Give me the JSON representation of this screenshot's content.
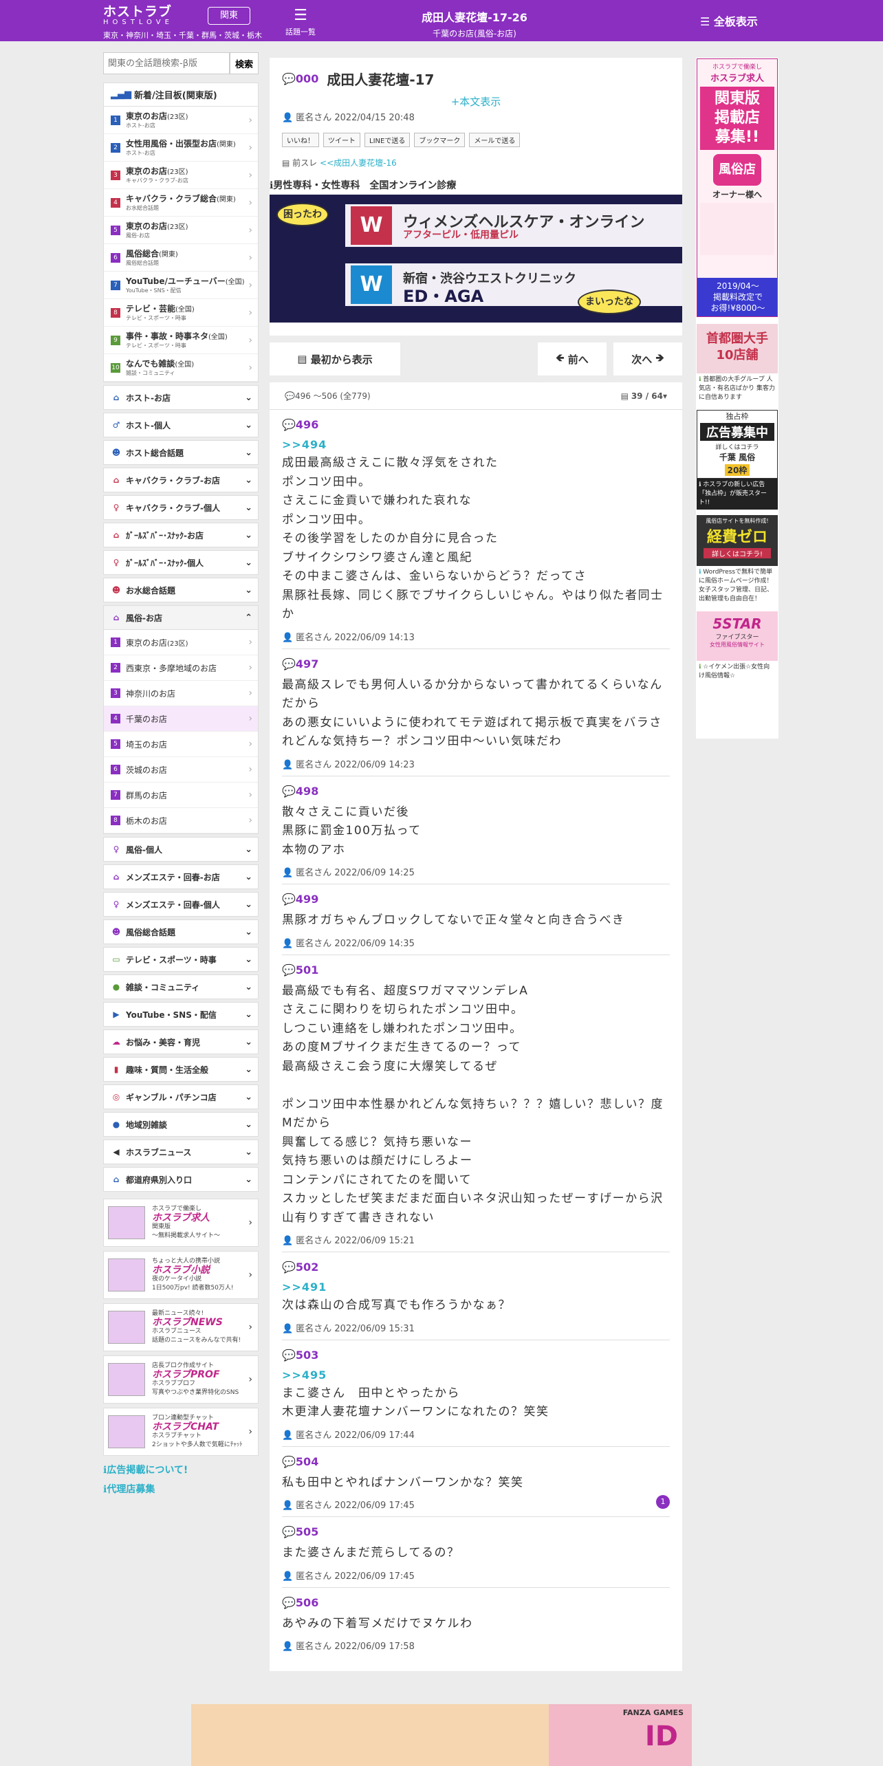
{
  "header": {
    "logo_main": "ホストラブ",
    "logo_sub": "HOSTLOVE",
    "region": "関東",
    "areas": "東京・神奈川・埼玉・千葉・群馬・茨城・栃木",
    "topics_label": "話題一覧",
    "thread_title": "成田人妻花壇-17-26",
    "thread_sub": "千葉のお店(風俗-お店)",
    "menu_label": "全板表示",
    "brand_color": "#8a2fc0"
  },
  "sidebar": {
    "search_placeholder": "関東の全話題検索-β版",
    "search_button": "検索",
    "box_title": "新着/注目板(関東版)",
    "boards": [
      {
        "n": "1",
        "color": "#2b5fb8",
        "name": "東京のお店",
        "scope": "(23区)",
        "sub": "ホスト-お店"
      },
      {
        "n": "2",
        "color": "#2b5fb8",
        "name": "女性用風俗・出張型お店",
        "scope": "(関東)",
        "sub": "ホスト-お店"
      },
      {
        "n": "3",
        "color": "#c4314b",
        "name": "東京のお店",
        "scope": "(23区)",
        "sub": "キャバクラ・クラブ-お店"
      },
      {
        "n": "4",
        "color": "#c4314b",
        "name": "キャバクラ・クラブ総合",
        "scope": "(関東)",
        "sub": "お水総合話題"
      },
      {
        "n": "5",
        "color": "#8a2fc0",
        "name": "東京のお店",
        "scope": "(23区)",
        "sub": "風俗-お店"
      },
      {
        "n": "6",
        "color": "#8a2fc0",
        "name": "風俗総合",
        "scope": "(関東)",
        "sub": "風俗総合話題"
      },
      {
        "n": "7",
        "color": "#2b5fb8",
        "name": "YouTube/ユーチューバー",
        "scope": "(全国)",
        "sub": "YouTube・SNS・配信"
      },
      {
        "n": "8",
        "color": "#c4314b",
        "name": "テレビ・芸能",
        "scope": "(全国)",
        "sub": "テレビ・スポーツ・時事"
      },
      {
        "n": "9",
        "color": "#5a9a3a",
        "name": "事件・事故・時事ネタ",
        "scope": "(全国)",
        "sub": "テレビ・スポーツ・時事"
      },
      {
        "n": "10",
        "color": "#5a9a3a",
        "name": "なんでも雑談",
        "scope": "(全国)",
        "sub": "雑談・コミュニティ"
      }
    ],
    "categories_a": [
      {
        "icon": "⌂",
        "color": "#2b5fb8",
        "label": "ホスト-お店",
        "chev": "⌄"
      },
      {
        "icon": "♂",
        "color": "#2b5fb8",
        "label": "ホスト-個人",
        "chev": "⌄"
      },
      {
        "icon": "☻",
        "color": "#2b5fb8",
        "label": "ホスト総合話題",
        "chev": "⌄"
      },
      {
        "icon": "⌂",
        "color": "#c4314b",
        "label": "キャバクラ・クラブ-お店",
        "chev": "⌄"
      },
      {
        "icon": "♀",
        "color": "#c4314b",
        "label": "キャバクラ・クラブ-個人",
        "chev": "⌄"
      },
      {
        "icon": "⌂",
        "color": "#c4314b",
        "label": "ｶﾞｰﾙｽﾞﾊﾞｰ･ｽﾅｯｸ-お店",
        "chev": "⌄"
      },
      {
        "icon": "♀",
        "color": "#c4314b",
        "label": "ｶﾞｰﾙｽﾞﾊﾞｰ･ｽﾅｯｸ-個人",
        "chev": "⌄"
      },
      {
        "icon": "☻",
        "color": "#c4314b",
        "label": "お水総合話題",
        "chev": "⌄"
      }
    ],
    "fuzoku_label": "風俗-お店",
    "fuzoku_chev": "⌃",
    "fuzoku_items": [
      {
        "n": "1",
        "label": "東京のお店",
        "scope": "(23区)"
      },
      {
        "n": "2",
        "label": "西東京・多摩地域のお店",
        "scope": ""
      },
      {
        "n": "3",
        "label": "神奈川のお店",
        "scope": ""
      },
      {
        "n": "4",
        "label": "千葉のお店",
        "scope": ""
      },
      {
        "n": "5",
        "label": "埼玉のお店",
        "scope": ""
      },
      {
        "n": "6",
        "label": "茨城のお店",
        "scope": ""
      },
      {
        "n": "7",
        "label": "群馬のお店",
        "scope": ""
      },
      {
        "n": "8",
        "label": "栃木のお店",
        "scope": ""
      }
    ],
    "categories_b": [
      {
        "icon": "♀",
        "color": "#8a2fc0",
        "label": "風俗-個人",
        "chev": "⌄"
      },
      {
        "icon": "⌂",
        "color": "#8a2fc0",
        "label": "メンズエステ・回春-お店",
        "chev": "⌄"
      },
      {
        "icon": "♀",
        "color": "#8a2fc0",
        "label": "メンズエステ・回春-個人",
        "chev": "⌄"
      },
      {
        "icon": "☻",
        "color": "#8a2fc0",
        "label": "風俗総合話題",
        "chev": "⌄"
      },
      {
        "icon": "▭",
        "color": "#5a9a3a",
        "label": "テレビ・スポーツ・時事",
        "chev": "⌄"
      },
      {
        "icon": "●",
        "color": "#5a9a3a",
        "label": "雑談・コミュニティ",
        "chev": "⌄"
      },
      {
        "icon": "▶",
        "color": "#2b5fb8",
        "label": "YouTube・SNS・配信",
        "chev": "⌄"
      },
      {
        "icon": "☁",
        "color": "#c0268a",
        "label": "お悩み・美容・育児",
        "chev": "⌄"
      },
      {
        "icon": "▮",
        "color": "#c4314b",
        "label": "趣味・質問・生活全般",
        "chev": "⌄"
      },
      {
        "icon": "◎",
        "color": "#c4314b",
        "label": "ギャンブル・パチンコ店",
        "chev": "⌄"
      },
      {
        "icon": "●",
        "color": "#2b5fb8",
        "label": "地域別雑談",
        "chev": "⌄"
      },
      {
        "icon": "◀",
        "color": "#333333",
        "label": "ホスラブニュース",
        "chev": "⌄"
      },
      {
        "icon": "⌂",
        "color": "#2b5fb8",
        "label": "都道府県別入り口",
        "chev": "⌄"
      }
    ],
    "banners": [
      {
        "tag": "ホスラブで働楽し",
        "title": "ホスラブ求人",
        "l1": "関東版",
        "l2": "〜無料掲載求人サイト〜"
      },
      {
        "tag": "ちょっと大人の携帯小説",
        "title": "ホスラブ小説",
        "l1": "夜のケータイ小説",
        "l2": "1日500万pv! 読者数50万人!"
      },
      {
        "tag": "最新ニュース続々!",
        "title": "ホスラブNEWS",
        "l1": "ホスラブニュース",
        "l2": "話題のニュースをみんなで共有!"
      },
      {
        "tag": "店長ブロク作成サイト",
        "title": "ホスラブPROF",
        "l1": "ホスラブプロフ",
        "l2": "写真やつぶやき業界特化のSNS"
      },
      {
        "tag": "ブロン連動型チャット",
        "title": "ホスラブCHAT",
        "l1": "ホスラブチャット",
        "l2": "2ショットや多人数で気軽にﾁｬｯﾄ"
      }
    ],
    "link_ad": "広告掲載について!",
    "link_agent": "代理店募集"
  },
  "thread": {
    "no": "000",
    "title": "成田人妻花壇-17",
    "show_body": "+本文表示",
    "meta": "匿名さん 2022/04/15 20:48",
    "shares": [
      "いいね！",
      "ツイート",
      "LINEで送る",
      "ブックマーク",
      "メールで送る"
    ],
    "prev_label": "前スレ",
    "prev_link": "<<成田人妻花壇-16",
    "ad_header": "男性専科・女性専科　全国オンライン診療",
    "ad_line1": "ウィメンズヘルスケア・オンライン",
    "ad_line1b": "アフターピル・低用量ピル",
    "ad_line2": "新宿・渋谷ウエストクリニック",
    "ad_line2b": "ED・AGA",
    "ad_bubble1": "困ったわ",
    "ad_bubble2": "まいったな",
    "nav_first": "最初から表示",
    "nav_prev": "前へ",
    "nav_next": "次へ",
    "range": "496 ～506 (全779)",
    "page": "39 / 64"
  },
  "posts": [
    {
      "no": "496",
      "anchor": ">>494",
      "body": "成田最高級さえこに散々浮気をされた\nポンコツ田中。\nさえこに金貢いで嫌われた哀れな\nポンコツ田中。\nその後学習をしたのか自分に見合った\nブサイクシワシワ婆さん達と風紀\nその中まこ婆さんは、金いらないからどう？だってさ\n黒豚社長嫁、同じく豚でブサイクらしいじゃん。やはり似た者同士か",
      "meta": "匿名さん 2022/06/09 14:13",
      "badge": ""
    },
    {
      "no": "497",
      "anchor": "",
      "body": "最高級スレでも男何人いるか分からないって書かれてるくらいなんだから\nあの悪女にいいように使われてモテ遊ばれて掲示板で真実をバラされどんな気持ちー？ポンコツ田中〜いい気味だわ",
      "meta": "匿名さん 2022/06/09 14:23",
      "badge": ""
    },
    {
      "no": "498",
      "anchor": "",
      "body": "散々さえこに貢いだ後\n黒豚に罰金100万払って\n本物のアホ",
      "meta": "匿名さん 2022/06/09 14:25",
      "badge": ""
    },
    {
      "no": "499",
      "anchor": "",
      "body": "黒豚オガちゃんブロックしてないで正々堂々と向き合うべき",
      "meta": "匿名さん 2022/06/09 14:35",
      "badge": ""
    },
    {
      "no": "501",
      "anchor": "",
      "body": "最高級でも有名、超度SワガママツンデレA\nさえこに関わりを切られたポンコツ田中。\nしつこい連絡をし嫌われたポンコツ田中。\nあの度Mブサイクまだ生きてるのー？って\n最高級さえこ会う度に大爆笑してるぜ\n\nポンコツ田中本性暴かれどんな気持ちぃ？？？嬉しい？悲しい？度Mだから\n興奮してる感じ？気持ち悪いなー\n気持ち悪いのは顔だけにしろよー\nコンテンパにされてたのを聞いて\nスカッとしたぜ笑まだまだ面白いネタ沢山知ったぜーすげーから沢山有りすぎて書ききれない",
      "meta": "匿名さん 2022/06/09 15:21",
      "badge": ""
    },
    {
      "no": "502",
      "anchor": ">>491",
      "body": "次は森山の合成写真でも作ろうかなぁ？",
      "meta": "匿名さん 2022/06/09 15:31",
      "badge": ""
    },
    {
      "no": "503",
      "anchor": ">>495",
      "body": "まこ婆さん　田中とやったから\n木更津人妻花壇ナンバーワンになれたの？笑笑",
      "meta": "匿名さん 2022/06/09 17:44",
      "badge": ""
    },
    {
      "no": "504",
      "anchor": "",
      "body": "私も田中とやればナンバーワンかな？笑笑",
      "meta": "匿名さん 2022/06/09 17:45",
      "badge": "1"
    },
    {
      "no": "505",
      "anchor": "",
      "body": "また婆さんまだ荒らしてるの？",
      "meta": "匿名さん 2022/06/09 17:45",
      "badge": ""
    },
    {
      "no": "506",
      "anchor": "",
      "body": "あやみの下着写メだけでヌケルわ",
      "meta": "匿名さん 2022/06/09 17:58",
      "badge": ""
    }
  ],
  "rail": {
    "ad1_tag": "ホスラブで働楽し",
    "ad1_brand": "ホスラブ求人",
    "ad1_big": "関東版\n掲載店\n募集!!",
    "ad1_circle": "風俗店",
    "ad1_owner": "オーナー様へ",
    "ad1_bottom": "2019/04〜\n掲載料改定で\nお得!¥8000〜",
    "ad2_title": "首都圏大手\n10店舗",
    "ad2_text": "首都圏の大手グループ 人気店・有名店ばかり 集客力に自信あります",
    "ad3_head": "独占枠",
    "ad3_title": "広告募集中",
    "ad3_sub": "詳しくはコチラ",
    "ad3_tags": "千葉 風俗",
    "ad3_badge": "20枠",
    "ad3_text": "ホスラブの新しい広告「独占枠」が販売スタート!!",
    "ad4_top": "風俗店サイトを無料作成!",
    "ad4_title": "経費ゼロ",
    "ad4_sub": "詳しくはコチラ!",
    "ad4_text": "WordPressで無料で簡単に風俗ホームページ作成！女子スタッフ管理、日記、出勤管理も自由自在！",
    "ad5_title": "5STAR",
    "ad5_sub": "ファイブスター",
    "ad5_caption": "女性用風俗情報サイト",
    "ad5_text": "☆イケメン出張☆女性向け風俗情報☆"
  },
  "footer_ad": {
    "brand": "FANZA GAMES",
    "title": "ID"
  }
}
